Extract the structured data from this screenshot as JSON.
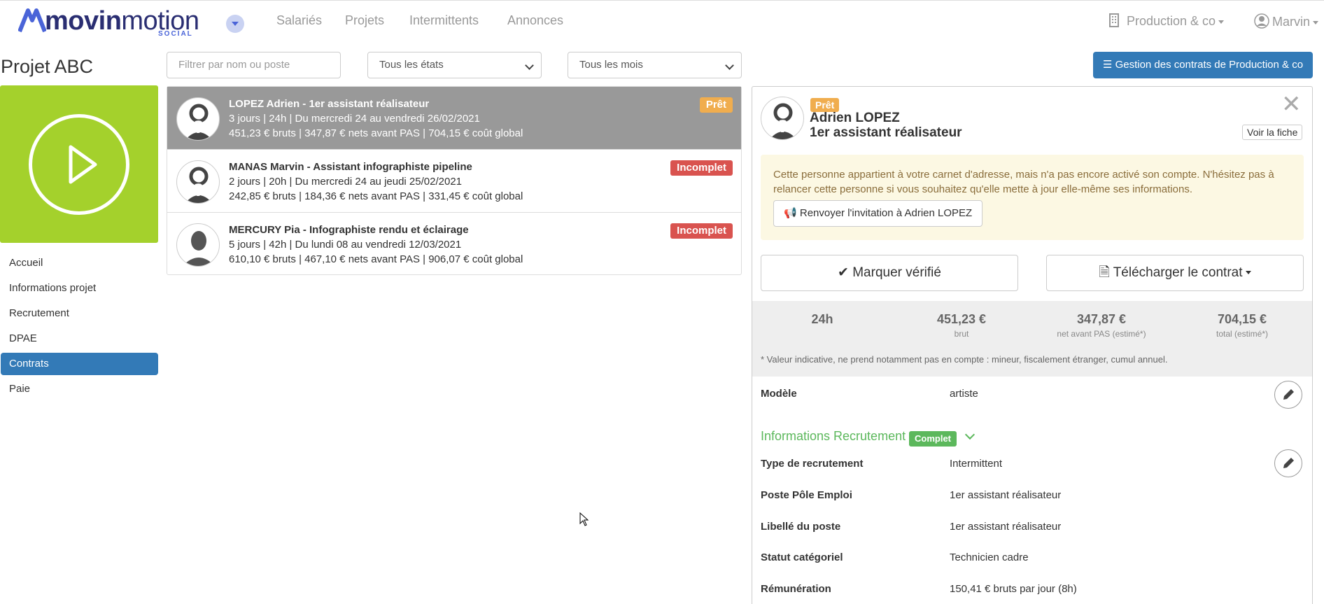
{
  "brand": {
    "logo_bold": "movin",
    "logo_rest": "motion",
    "tagline": "SOCIAL"
  },
  "nav": {
    "items": [
      "Salariés",
      "Projets",
      "Intermittents",
      "Annonces"
    ],
    "company": "Production & co",
    "user": "Marvin"
  },
  "project": {
    "title": "Projet ABC"
  },
  "sidebar": {
    "items": [
      "Accueil",
      "Informations projet",
      "Recrutement",
      "DPAE",
      "Contrats",
      "Paie"
    ],
    "active": "Contrats"
  },
  "filters": {
    "search_placeholder": "Filtrer par nom ou poste",
    "state": "Tous les états",
    "month": "Tous les mois"
  },
  "actions": {
    "manage_contracts": "Gestion des contrats de Production & co"
  },
  "contracts": [
    {
      "title": "LOPEZ Adrien - 1er assistant réalisateur",
      "line2": "3 jours | 24h | Du mercredi 24 au vendredi 26/02/2021",
      "line3": "451,23 € bruts | 347,87 € nets avant PAS | 704,15 € coût global",
      "status": "Prêt"
    },
    {
      "title": "MANAS Marvin - Assistant infographiste pipeline",
      "line2": "2 jours | 20h | Du mercredi 24 au jeudi 25/02/2021",
      "line3": "242,85 € bruts | 184,36 € nets avant PAS | 331,45 € coût global",
      "status": "Incomplet"
    },
    {
      "title": "MERCURY Pia - Infographiste rendu et éclairage",
      "line2": "5 jours | 42h | Du lundi 08 au vendredi 12/03/2021",
      "line3": "610,10 € bruts | 467,10 € nets avant PAS | 906,07 € coût global",
      "status": "Incomplet"
    }
  ],
  "detail": {
    "status": "Prêt",
    "name": "Adrien LOPEZ",
    "role": "1er assistant réalisateur",
    "close": "✕",
    "view_profile": "Voir la fiche",
    "alert_text": "Cette personne appartient à votre carnet d'adresse, mais n'a pas encore activé son compte. N'hésitez pas à relancer cette personne si vous souhaitez qu'elle mette à jour elle-même ses informations.",
    "resend": "Renvoyer l'invitation à Adrien LOPEZ",
    "mark_verified": "Marquer vérifié",
    "download": "Télécharger le contrat",
    "stats": [
      {
        "value": "24h",
        "sub": ""
      },
      {
        "value": "451,23 €",
        "sub": "brut"
      },
      {
        "value": "347,87 €",
        "sub": "net avant PAS (estimé*)"
      },
      {
        "value": "704,15 €",
        "sub": "total (estimé*)"
      }
    ],
    "note": "* Valeur indicative, ne prend notamment pas en compte : mineur, fiscalement étranger, cumul annuel.",
    "model_label": "Modèle",
    "model_value": "artiste",
    "section_title": "Informations Recrutement",
    "section_badge": "Complet",
    "fields": [
      {
        "label": "Type de recrutement",
        "value": "Intermittent"
      },
      {
        "label": "Poste Pôle Emploi",
        "value": "1er assistant réalisateur"
      },
      {
        "label": "Libellé du poste",
        "value": "1er assistant réalisateur"
      },
      {
        "label": "Statut catégoriel",
        "value": "Technicien cadre"
      },
      {
        "label": "Rémunération",
        "value": "150,41 € bruts par jour (8h)"
      }
    ]
  },
  "colors": {
    "primary": "#337ab7",
    "lime": "#a4d12c",
    "ready": "#f0ad4e",
    "incomplete": "#d9534f",
    "complete": "#5cb85c"
  }
}
